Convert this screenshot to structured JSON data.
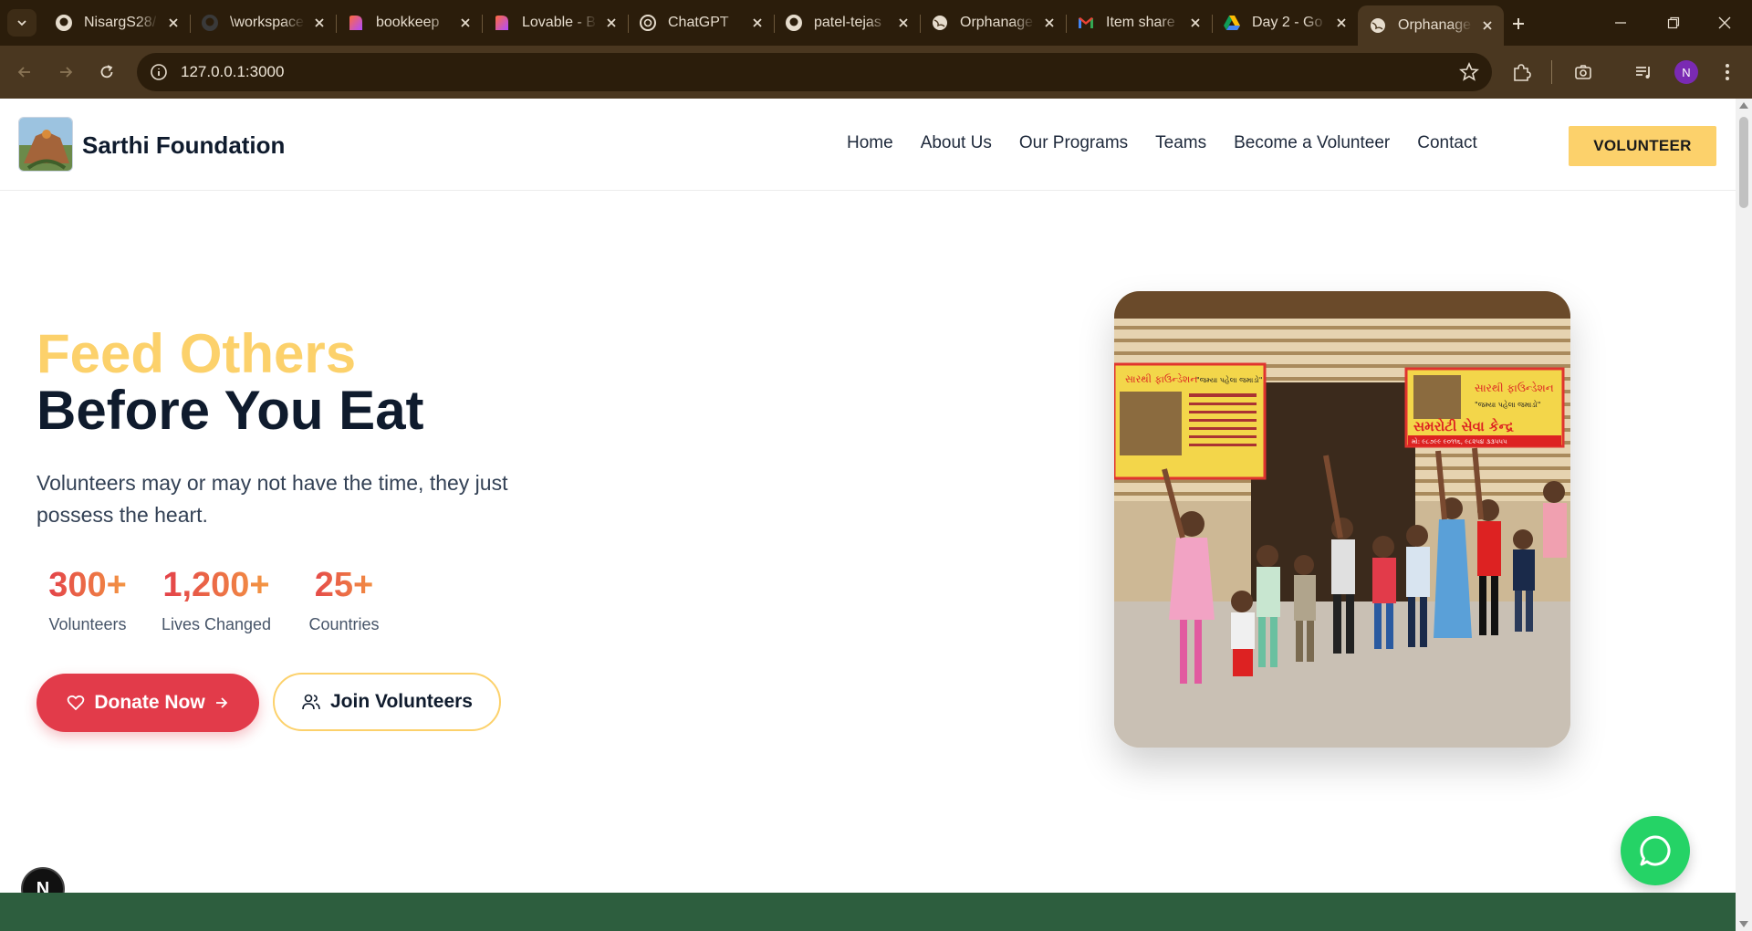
{
  "browser": {
    "tabs": [
      {
        "title": "NisargS28/",
        "icon": "github-icon"
      },
      {
        "title": "\\workspace",
        "icon": "github-icon"
      },
      {
        "title": "bookkeep",
        "icon": "lovable-icon"
      },
      {
        "title": "Lovable - B",
        "icon": "lovable-icon"
      },
      {
        "title": "ChatGPT",
        "icon": "chatgpt-icon"
      },
      {
        "title": "patel-tejas",
        "icon": "github-icon"
      },
      {
        "title": "Orphanage",
        "icon": "globe-icon"
      },
      {
        "title": "Item share",
        "icon": "gmail-icon"
      },
      {
        "title": "Day 2 - Go",
        "icon": "drive-icon"
      },
      {
        "title": "Orphanage",
        "icon": "globe-icon",
        "active": true
      }
    ],
    "url": "127.0.0.1:3000",
    "profile_initial": "N"
  },
  "site": {
    "brand": "Sarthi Foundation",
    "nav": [
      "Home",
      "About Us",
      "Our Programs",
      "Teams",
      "Become a Volunteer",
      "Contact"
    ],
    "cta": "VOLUNTEER"
  },
  "hero": {
    "title_line1": "Feed Others",
    "title_line2": "Before You Eat",
    "subtitle": "Volunteers may or may not have the time, they just possess the heart.",
    "stats": [
      {
        "value": "300+",
        "label": "Volunteers"
      },
      {
        "value": "1,200+",
        "label": "Lives Changed"
      },
      {
        "value": "25+",
        "label": "Countries"
      }
    ],
    "donate_label": "Donate Now",
    "join_label": "Join Volunteers",
    "photo_signs": {
      "left_heading": "સારથી ફાઉન્ડેશન",
      "left_tag": "\"જમ્યા પહેલા જમાડો\"",
      "right_heading": "સારથી ફાઉન્ડેશન",
      "right_tag": "\"જમ્યા પહેલા જમાડો\"",
      "right_title": "સમરોટી સેવા કેન્દ્ર",
      "right_phone": "મો: ૯૮૭૯૯ ૯૦૧૧૬, ૯૮૨૫૪ ૩૩૫૫૫"
    }
  },
  "colors": {
    "accent_yellow": "#fcd16b",
    "donate_red": "#e23b4a",
    "whatsapp_green": "#25d366",
    "footer_green": "#2d5e3e",
    "chrome_brown": "#2b1d0b"
  }
}
